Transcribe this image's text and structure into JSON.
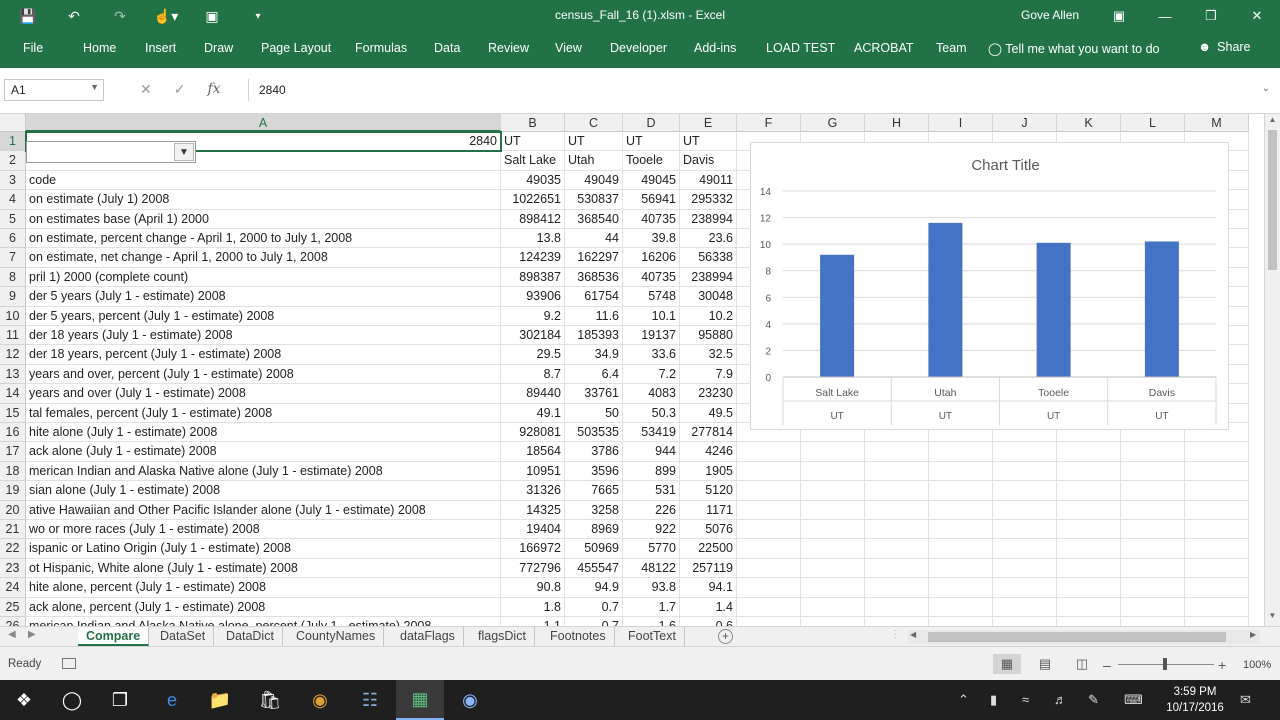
{
  "window": {
    "title": "census_Fall_16 (1).xlsm - Excel",
    "user": "Gove Allen"
  },
  "ribbon": {
    "tabs": [
      "File",
      "Home",
      "Insert",
      "Draw",
      "Page Layout",
      "Formulas",
      "Data",
      "Review",
      "View",
      "Developer",
      "Add-ins",
      "LOAD TEST",
      "ACROBAT",
      "Team"
    ],
    "tell_me": "Tell me what you want to do",
    "share": "Share"
  },
  "formula_bar": {
    "name_box": "A1",
    "fx": "fx",
    "value": "2840"
  },
  "columns": [
    "A",
    "B",
    "C",
    "D",
    "E",
    "F",
    "G",
    "H",
    "I",
    "J",
    "K",
    "L",
    "M"
  ],
  "rows": [
    {
      "n": "1",
      "a": "2840",
      "b": "UT",
      "c": "UT",
      "d": "UT",
      "e": "UT"
    },
    {
      "n": "2",
      "a": "",
      "b": "Salt Lake",
      "c": "Utah",
      "d": "Tooele",
      "e": "Davis"
    },
    {
      "n": "3",
      "a": "code",
      "b": "49035",
      "c": "49049",
      "d": "49045",
      "e": "49011"
    },
    {
      "n": "4",
      "a": "on estimate (July 1) 2008",
      "b": "1022651",
      "c": "530837",
      "d": "56941",
      "e": "295332"
    },
    {
      "n": "5",
      "a": "on estimates base (April 1) 2000",
      "b": "898412",
      "c": "368540",
      "d": "40735",
      "e": "238994"
    },
    {
      "n": "6",
      "a": "on estimate, percent change - April 1, 2000 to July 1, 2008",
      "b": "13.8",
      "c": "44",
      "d": "39.8",
      "e": "23.6"
    },
    {
      "n": "7",
      "a": "on estimate, net change - April 1, 2000 to July 1, 2008",
      "b": "124239",
      "c": "162297",
      "d": "16206",
      "e": "56338"
    },
    {
      "n": "8",
      "a": "pril 1) 2000 (complete count)",
      "b": "898387",
      "c": "368536",
      "d": "40735",
      "e": "238994"
    },
    {
      "n": "9",
      "a": "der 5 years (July 1 - estimate) 2008",
      "b": "93906",
      "c": "61754",
      "d": "5748",
      "e": "30048"
    },
    {
      "n": "10",
      "a": "der 5 years, percent (July 1 - estimate) 2008",
      "b": "9.2",
      "c": "11.6",
      "d": "10.1",
      "e": "10.2"
    },
    {
      "n": "11",
      "a": "der 18 years (July 1 - estimate) 2008",
      "b": "302184",
      "c": "185393",
      "d": "19137",
      "e": "95880"
    },
    {
      "n": "12",
      "a": "der 18 years, percent (July 1 - estimate) 2008",
      "b": "29.5",
      "c": "34.9",
      "d": "33.6",
      "e": "32.5"
    },
    {
      "n": "13",
      "a": " years and over, percent (July 1 - estimate) 2008",
      "b": "8.7",
      "c": "6.4",
      "d": "7.2",
      "e": "7.9"
    },
    {
      "n": "14",
      "a": " years and over (July 1 - estimate) 2008",
      "b": "89440",
      "c": "33761",
      "d": "4083",
      "e": "23230"
    },
    {
      "n": "15",
      "a": "tal females, percent (July 1 - estimate) 2008",
      "b": "49.1",
      "c": "50",
      "d": "50.3",
      "e": "49.5"
    },
    {
      "n": "16",
      "a": "hite alone (July 1 - estimate) 2008",
      "b": "928081",
      "c": "503535",
      "d": "53419",
      "e": "277814"
    },
    {
      "n": "17",
      "a": "ack alone (July 1 - estimate) 2008",
      "b": "18564",
      "c": "3786",
      "d": "944",
      "e": "4246"
    },
    {
      "n": "18",
      "a": "merican Indian and Alaska Native alone (July 1 - estimate) 2008",
      "b": "10951",
      "c": "3596",
      "d": "899",
      "e": "1905"
    },
    {
      "n": "19",
      "a": "sian alone (July 1 - estimate) 2008",
      "b": "31326",
      "c": "7665",
      "d": "531",
      "e": "5120"
    },
    {
      "n": "20",
      "a": "ative Hawaiian and Other Pacific Islander alone (July 1 - estimate) 2008",
      "b": "14325",
      "c": "3258",
      "d": "226",
      "e": "1171"
    },
    {
      "n": "21",
      "a": "wo or more races (July 1 - estimate) 2008",
      "b": "19404",
      "c": "8969",
      "d": "922",
      "e": "5076"
    },
    {
      "n": "22",
      "a": "ispanic or Latino Origin (July 1 - estimate) 2008",
      "b": "166972",
      "c": "50969",
      "d": "5770",
      "e": "22500"
    },
    {
      "n": "23",
      "a": "ot Hispanic, White alone (July 1 - estimate) 2008",
      "b": "772796",
      "c": "455547",
      "d": "48122",
      "e": "257119"
    },
    {
      "n": "24",
      "a": "hite alone, percent (July 1 - estimate) 2008",
      "b": "90.8",
      "c": "94.9",
      "d": "93.8",
      "e": "94.1"
    },
    {
      "n": "25",
      "a": "ack alone, percent (July 1 - estimate) 2008",
      "b": "1.8",
      "c": "0.7",
      "d": "1.7",
      "e": "1.4"
    },
    {
      "n": "26",
      "a": "merican Indian and Alaska Native alone, percent (July 1 - estimate) 2008",
      "b": "1.1",
      "c": "0.7",
      "d": "1.6",
      "e": "0.6"
    }
  ],
  "chart_data": {
    "type": "bar",
    "title": "Chart Title",
    "categories": [
      "Salt Lake",
      "Utah",
      "Tooele",
      "Davis"
    ],
    "category_groups": [
      "UT",
      "UT",
      "UT",
      "UT"
    ],
    "values": [
      9.2,
      11.6,
      10.1,
      10.2
    ],
    "ylim": [
      0,
      14
    ],
    "yticks": [
      0,
      2,
      4,
      6,
      8,
      10,
      12,
      14
    ],
    "color": "#4472C4",
    "grid": true,
    "legend": "none"
  },
  "sheets": [
    "Compare",
    "DataSet",
    "DataDict",
    "CountyNames",
    "dataFlags",
    "flagsDict",
    "Footnotes",
    "FootText"
  ],
  "active_sheet": "Compare",
  "status": {
    "ready": "Ready",
    "zoom": "100%"
  },
  "taskbar": {
    "time": "3:59 PM",
    "date": "10/17/2016"
  },
  "theme": {
    "accent": "#217346",
    "bar": "#4472C4"
  }
}
